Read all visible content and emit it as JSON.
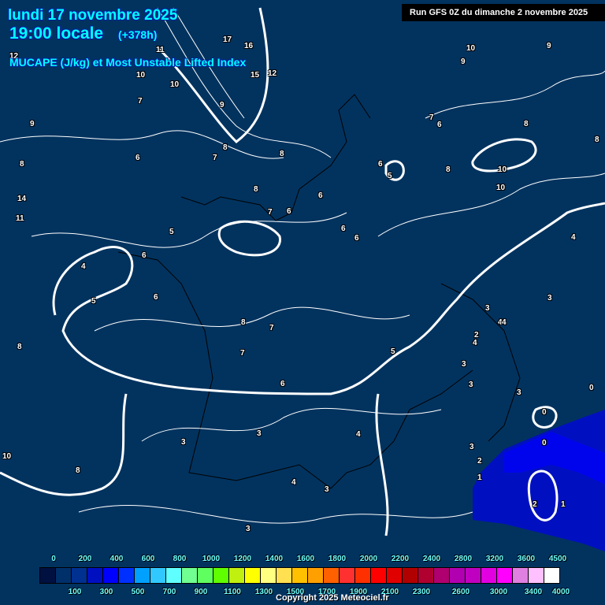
{
  "header": {
    "date": "lundi 17 novembre 2025",
    "time": "19:00 locale",
    "lead": "(+378h)",
    "title": "MUCAPE (J/kg) et Most Unstable Lifted Index",
    "run": "Run GFS 0Z du dimanche 2 novembre 2025"
  },
  "map": {
    "background_color": "#02335f",
    "cape_color": "#0010c0",
    "cape_strong_color": "#0000ff",
    "contour_labels": [
      "12",
      "10",
      "11",
      "17",
      "16",
      "15",
      "12",
      "10",
      "9",
      "8",
      "14",
      "11",
      "9",
      "8",
      "7",
      "7",
      "8",
      "6",
      "10",
      "8",
      "10",
      "9",
      "6",
      "7",
      "8",
      "5",
      "6",
      "6",
      "6",
      "6",
      "5",
      "7",
      "6",
      "4",
      "8",
      "6",
      "10",
      "9",
      "4",
      "5",
      "6",
      "8",
      "7",
      "7",
      "5",
      "3",
      "4",
      "3",
      "8",
      "4",
      "2",
      "3",
      "3",
      "3",
      "3",
      "4",
      "3",
      "8",
      "10",
      "3",
      "4",
      "4",
      "3",
      "0",
      "0",
      "2",
      "1",
      "0",
      "2",
      "1",
      "3",
      "6",
      "8"
    ]
  },
  "legend": {
    "colors": [
      "#001040",
      "#00306a",
      "#003090",
      "#0010c0",
      "#0000ff",
      "#0030ff",
      "#00a0ff",
      "#30c8ff",
      "#60ffff",
      "#70ff90",
      "#60ff60",
      "#60ff00",
      "#c0f010",
      "#ffff00",
      "#ffff80",
      "#ffe050",
      "#ffc000",
      "#ffa000",
      "#ff6000",
      "#ff3030",
      "#ff3000",
      "#ff0000",
      "#e00000",
      "#b00000",
      "#b00030",
      "#b00070",
      "#b000b0",
      "#c000c0",
      "#e000e0",
      "#ff00ff",
      "#e080e0",
      "#ffc0ff",
      "#ffffff"
    ],
    "top_labels": [
      "0",
      "200",
      "400",
      "600",
      "800",
      "1000",
      "1200",
      "1400",
      "1600",
      "1800",
      "2000",
      "2200",
      "2400",
      "2800",
      "3200",
      "3600",
      "4500"
    ],
    "bottom_labels": [
      "100",
      "300",
      "500",
      "700",
      "900",
      "1100",
      "1300",
      "1500",
      "1700",
      "1900",
      "2100",
      "2300",
      "2600",
      "3000",
      "3400",
      "4000"
    ]
  },
  "footer": {
    "copyright": "Copyright 2025 Meteociel.fr"
  }
}
